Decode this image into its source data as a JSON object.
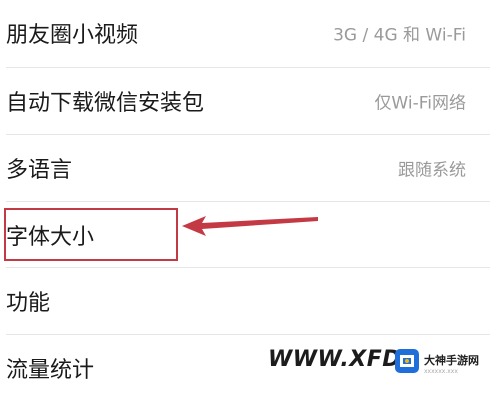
{
  "settings": {
    "items": [
      {
        "label": "朋友圈小视频",
        "value": "3G / 4G 和 Wi-Fi"
      },
      {
        "label": "自动下载微信安装包",
        "value": "仅Wi-Fi网络"
      },
      {
        "label": "多语言",
        "value": "跟随系统"
      },
      {
        "label": "字体大小",
        "value": ""
      },
      {
        "label": "功能",
        "value": ""
      },
      {
        "label": "流量统计",
        "value": ""
      }
    ]
  },
  "annotation": {
    "highlight_color": "#c33a44",
    "highlighted_item": "字体大小"
  },
  "watermark": {
    "text": "WWW.XFDO",
    "logo_text": "大神手游网",
    "logo_sub": "xxxxxx.xxx",
    "icon": "site-logo-icon"
  }
}
